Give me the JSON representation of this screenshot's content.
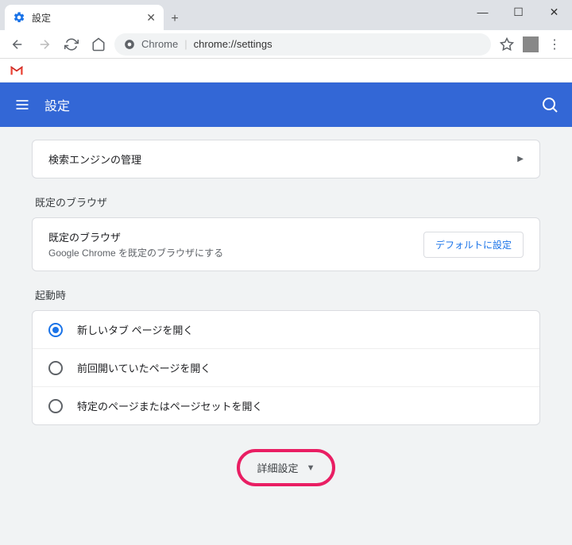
{
  "window": {
    "minimize": "—",
    "maximize": "☐",
    "close": "✕"
  },
  "tab": {
    "title": "設定",
    "close": "✕"
  },
  "addr": {
    "origin": "Chrome",
    "path": "chrome://settings"
  },
  "header": {
    "title": "設定"
  },
  "searchEngineRow": {
    "label": "検索エンジンの管理"
  },
  "defaultBrowser": {
    "section": "既定のブラウザ",
    "title": "既定のブラウザ",
    "sub": "Google Chrome を既定のブラウザにする",
    "button": "デフォルトに設定"
  },
  "startup": {
    "section": "起動時",
    "opt1": "新しいタブ ページを開く",
    "opt2": "前回開いていたページを開く",
    "opt3": "特定のページまたはページセットを開く"
  },
  "advanced": {
    "label": "詳細設定"
  }
}
